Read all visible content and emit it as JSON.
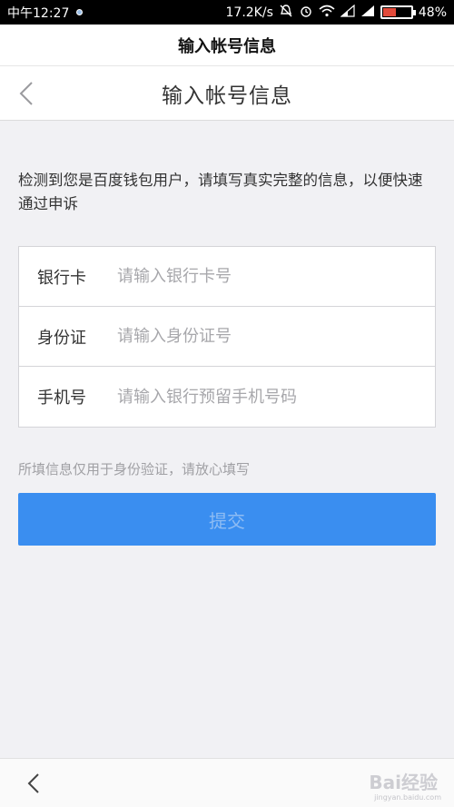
{
  "status_bar": {
    "time": "中午12:27",
    "speed": "17.2K/s",
    "battery": "48%",
    "battery_level": 0.48
  },
  "app_title": "输入帐号信息",
  "nav": {
    "title": "输入帐号信息"
  },
  "notice": "检测到您是百度钱包用户，请填写真实完整的信息，以便快速通过申诉",
  "form": {
    "rows": [
      {
        "label": "银行卡",
        "placeholder": "请输入银行卡号",
        "value": ""
      },
      {
        "label": "身份证",
        "placeholder": "请输入身份证号",
        "value": ""
      },
      {
        "label": "手机号",
        "placeholder": "请输入银行预留手机号码",
        "value": ""
      }
    ]
  },
  "hint": "所填信息仅用于身份验证，请放心填写",
  "submit_label": "提交",
  "watermark": {
    "text": "Bai经验",
    "sub": "jingyan.baidu.com"
  },
  "colors": {
    "accent": "#3a8ef0",
    "battery": "#e24a3a"
  }
}
